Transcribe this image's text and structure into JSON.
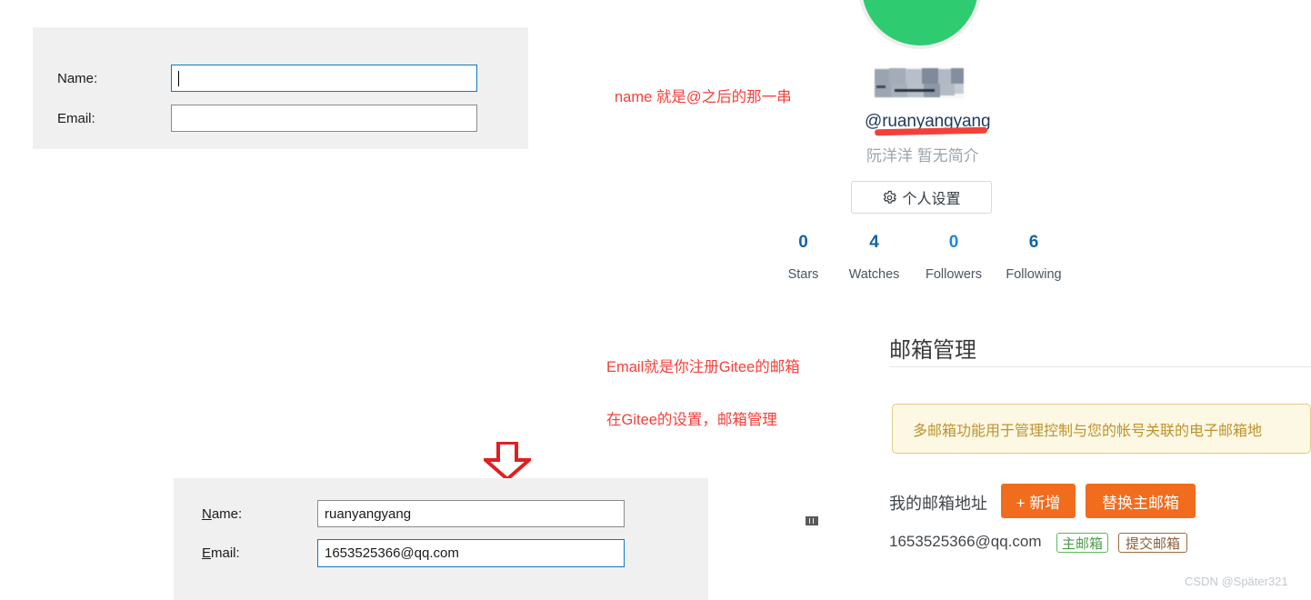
{
  "top_form": {
    "name_label": "Name:",
    "name_value": "",
    "email_label": "Email:",
    "email_value": ""
  },
  "bottom_form": {
    "name_label_accel": "N",
    "name_label_rest": "ame:",
    "name_value": "ruanyangyang",
    "email_label_accel": "E",
    "email_label_rest": "mail:",
    "email_value": "1653525366@qq.com"
  },
  "annotations": {
    "name_hint": "name 就是@之后的那一串",
    "email_hint": "Email就是你注册Gitee的邮箱",
    "email_hint2": "在Gitee的设置，邮箱管理"
  },
  "profile": {
    "handle": "@ruanyangyang",
    "bio": "阮洋洋 暂无简介",
    "settings_button": "个人设置",
    "settings_icon": "gear-icon",
    "stats": [
      {
        "num": "0",
        "label": "Stars"
      },
      {
        "num": "4",
        "label": "Watches"
      },
      {
        "num": "0",
        "label": "Followers"
      },
      {
        "num": "6",
        "label": "Following"
      }
    ]
  },
  "email_section": {
    "title": "邮箱管理",
    "notice": "多邮箱功能用于管理控制与您的帐号关联的电子邮箱地",
    "my_email_label": "我的邮箱地址",
    "add_button": "+ 新增",
    "replace_button": "替换主邮箱",
    "address": "1653525366@qq.com",
    "primary_tag": "主邮箱",
    "submit_tag": "提交邮箱"
  },
  "watermark": "CSDN @Später321",
  "colors": {
    "annotation_red": "#f4403a",
    "orange": "#f26c1e",
    "green_avatar": "#2ecb71",
    "handle_blue": "#1f3a5f",
    "stat_blue": "#1464a0",
    "notice_bg": "#fcf8e3",
    "notice_border": "#dfc98a",
    "notice_text": "#c0922c"
  }
}
